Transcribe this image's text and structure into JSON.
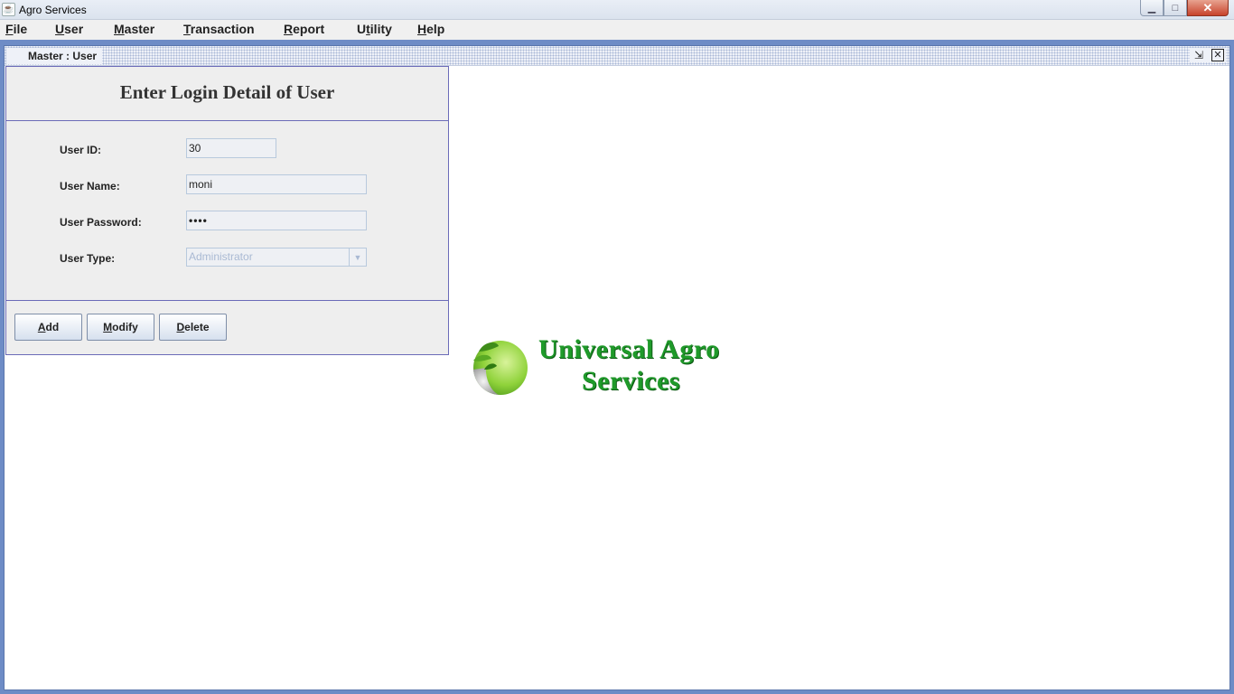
{
  "window": {
    "title": "Agro Services",
    "controls": {
      "minimize": "▁",
      "maximize": "□",
      "close": "✕"
    }
  },
  "menubar": {
    "items": [
      {
        "key": "F",
        "rest": "ile"
      },
      {
        "key": "U",
        "rest": "ser"
      },
      {
        "key": "M",
        "rest": "aster"
      },
      {
        "key": "T",
        "rest": "ransaction"
      },
      {
        "key": "R",
        "rest": "eport"
      },
      {
        "pre": "U",
        "key": "t",
        "rest": "ility"
      },
      {
        "key": "H",
        "rest": "elp"
      }
    ]
  },
  "internal_frame": {
    "title": "Master : User",
    "icons": {
      "frame": "window-icon",
      "restore": "restore-icon",
      "close": "close-icon"
    }
  },
  "form": {
    "heading": "Enter Login Detail of User",
    "fields": {
      "user_id": {
        "label": "User ID:",
        "value": "30"
      },
      "user_name": {
        "label": "User Name:",
        "value": "moni"
      },
      "user_password": {
        "label": "User Password:",
        "value": "••••"
      },
      "user_type": {
        "label": "User Type:",
        "value": "Administrator"
      }
    }
  },
  "buttons": {
    "add": {
      "key": "A",
      "rest": "dd"
    },
    "modify": {
      "key": "M",
      "rest": "odify"
    },
    "delete": {
      "key": "D",
      "rest": "elete"
    }
  },
  "logo": {
    "line1": "Universal Agro",
    "line2": "Services",
    "color": "#1f9a2a"
  },
  "colors": {
    "desktop_bg": "#6e8cc6",
    "panel_border": "#6b6bb8",
    "panel_bg": "#eeeeee"
  }
}
